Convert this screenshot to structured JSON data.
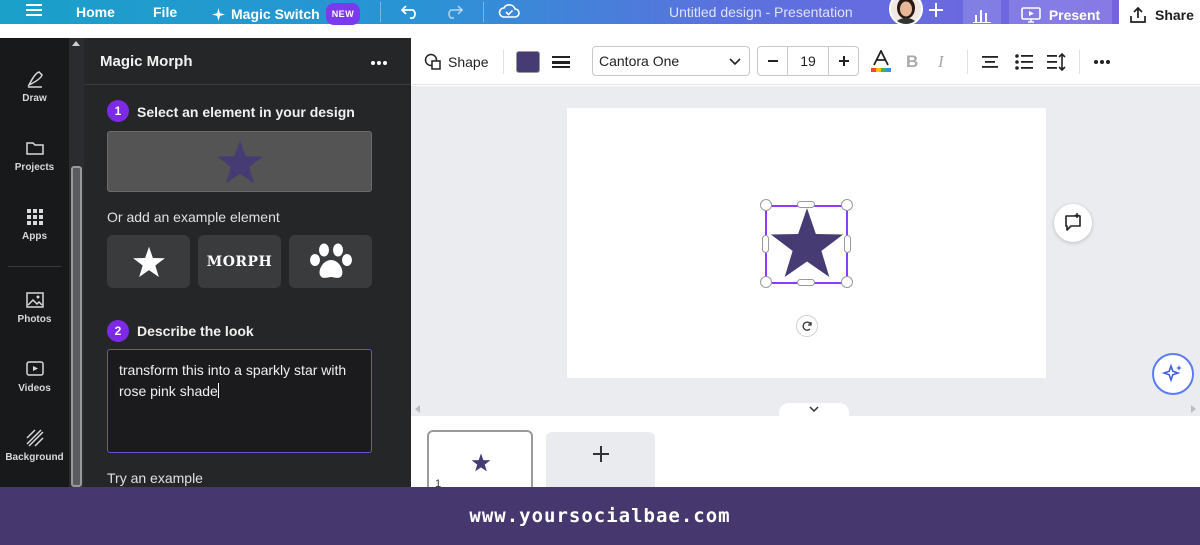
{
  "topbar": {
    "home": "Home",
    "file": "File",
    "magic_switch": "Magic Switch",
    "new_badge": "NEW",
    "design_title": "Untitled design - Presentation",
    "present": "Present",
    "share": "Share"
  },
  "rail": {
    "items": [
      {
        "label": "Draw",
        "icon": "draw-icon"
      },
      {
        "label": "Projects",
        "icon": "folder-icon"
      },
      {
        "label": "Apps",
        "icon": "apps-grid-icon"
      },
      {
        "label": "Photos",
        "icon": "image-icon"
      },
      {
        "label": "Videos",
        "icon": "video-icon"
      },
      {
        "label": "Background",
        "icon": "pattern-icon"
      }
    ]
  },
  "panel": {
    "title": "Magic Morph",
    "step1_num": "1",
    "step1_label": "Select an element in your design",
    "or_label": "Or add an example element",
    "example_morph": "MORPH",
    "step2_num": "2",
    "step2_label": "Describe the look",
    "description": "transform this into a sparkly star with rose pink shade",
    "try_label": "Try an example"
  },
  "toolbar": {
    "shape_label": "Shape",
    "fill_color": "#463b73",
    "font_name": "Cantora One",
    "font_size": "19"
  },
  "colors": {
    "star": "#463b73",
    "accent": "#8b3dff",
    "footer_bg": "#46386e"
  },
  "strip": {
    "page_number": "1"
  },
  "footer": {
    "text": "www.yoursocialbae.com"
  }
}
